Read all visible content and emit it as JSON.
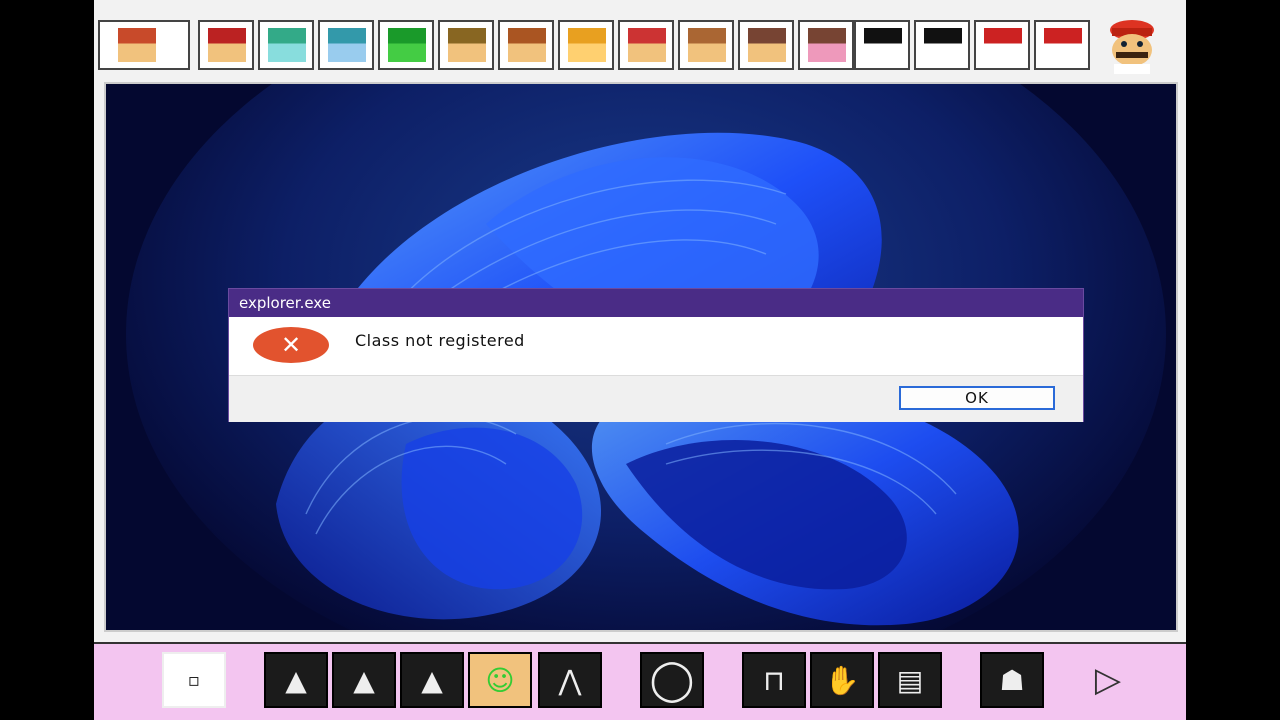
{
  "dialog": {
    "title": "explorer.exe",
    "message": "Class not registered",
    "ok_label": "OK",
    "icon": "error-icon"
  },
  "top_strip": {
    "stamps": [
      {
        "name": "stamp-slot-1-icon"
      },
      {
        "name": "stamp-slot-2-icon"
      },
      {
        "name": "stamp-slot-3-icon"
      },
      {
        "name": "stamp-slot-4-icon"
      },
      {
        "name": "stamp-slot-5-icon"
      },
      {
        "name": "stamp-slot-6-icon"
      },
      {
        "name": "stamp-slot-7-icon"
      },
      {
        "name": "stamp-slot-8-icon"
      },
      {
        "name": "stamp-slot-9-icon"
      },
      {
        "name": "stamp-slot-10-icon"
      },
      {
        "name": "stamp-slot-11-icon"
      },
      {
        "name": "stamp-slot-12-icon"
      },
      {
        "name": "stamp-slot-13-icon"
      },
      {
        "name": "stamp-slot-14-icon"
      },
      {
        "name": "stamp-slot-15-icon"
      },
      {
        "name": "stamp-slot-16-icon"
      }
    ],
    "corner": "mario-face-icon"
  },
  "bottom_bar": {
    "tools": [
      "small-square-tool-icon",
      "spray-small-tool-icon",
      "spray-medium-tool-icon",
      "spray-large-tool-icon",
      "luigi-face-icon",
      "spray-cone-tool-icon",
      "ring-brush-icon",
      "pipe-tool-icon",
      "glove-hand-icon",
      "eraser-icon",
      "dog-face-icon",
      "next-arrow-icon"
    ]
  },
  "colors": {
    "titlebar": "#4a2c86",
    "error_icon": "#e2532e",
    "ok_border": "#2a6ad8",
    "toolbar_bg": "#f3c5f0",
    "wallpaper_bg": "#050a3a",
    "wallpaper_accent": "#1f52ff"
  }
}
